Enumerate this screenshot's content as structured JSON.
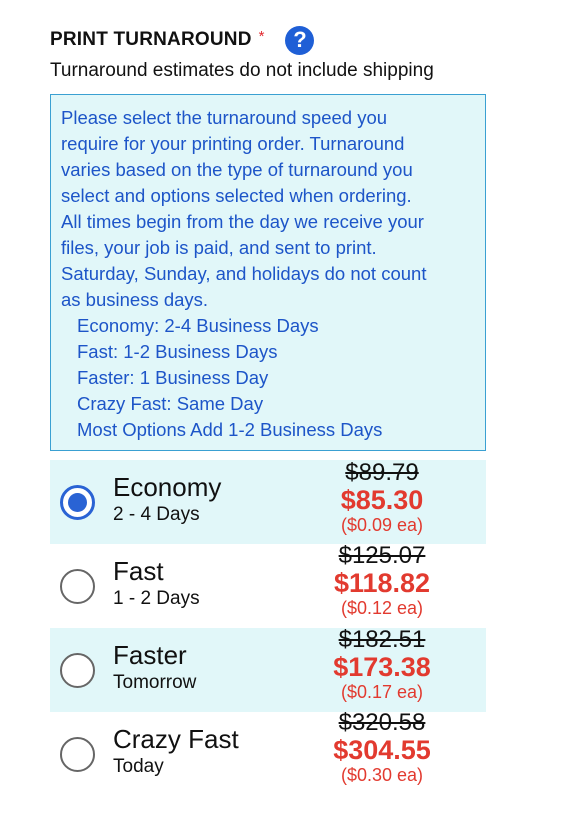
{
  "header": {
    "title": "PRINT TURNAROUND",
    "required_mark": "*",
    "help_icon": "?"
  },
  "subtitle": "Turnaround estimates do not include shipping",
  "info": {
    "paragraph_lines": [
      "Please select the turnaround speed you",
      "require for your printing order. Turnaround",
      "varies based on the type of turnaround you",
      "select and options selected when ordering.",
      "All times begin from the day we receive your",
      "files, your job is paid, and sent to print.",
      "Saturday, Sunday, and holidays do not count",
      "as business days."
    ],
    "list": [
      "Economy: 2-4 Business Days",
      "Fast: 1-2 Business Days",
      "Faster: 1 Business Day",
      "Crazy Fast: Same Day",
      "Most Options Add 1-2 Business Days"
    ]
  },
  "options": [
    {
      "name": "Economy",
      "days": "2 - 4 Days",
      "old_price": "$89.79",
      "price": "$85.30",
      "each": "($0.09 ea)",
      "selected": true
    },
    {
      "name": "Fast",
      "days": "1 - 2 Days",
      "old_price": "$125.07",
      "price": "$118.82",
      "each": "($0.12 ea)",
      "selected": false
    },
    {
      "name": "Faster",
      "days": "Tomorrow",
      "old_price": "$182.51",
      "price": "$173.38",
      "each": "($0.17 ea)",
      "selected": false
    },
    {
      "name": "Crazy Fast",
      "days": "Today",
      "old_price": "$320.58",
      "price": "$304.55",
      "each": "($0.30 ea)",
      "selected": false
    }
  ],
  "colors": {
    "accent_blue": "#2a63d4",
    "info_text": "#1d55c8",
    "panel_bg": "#e1f7f9",
    "price_red": "#e23a2f"
  }
}
